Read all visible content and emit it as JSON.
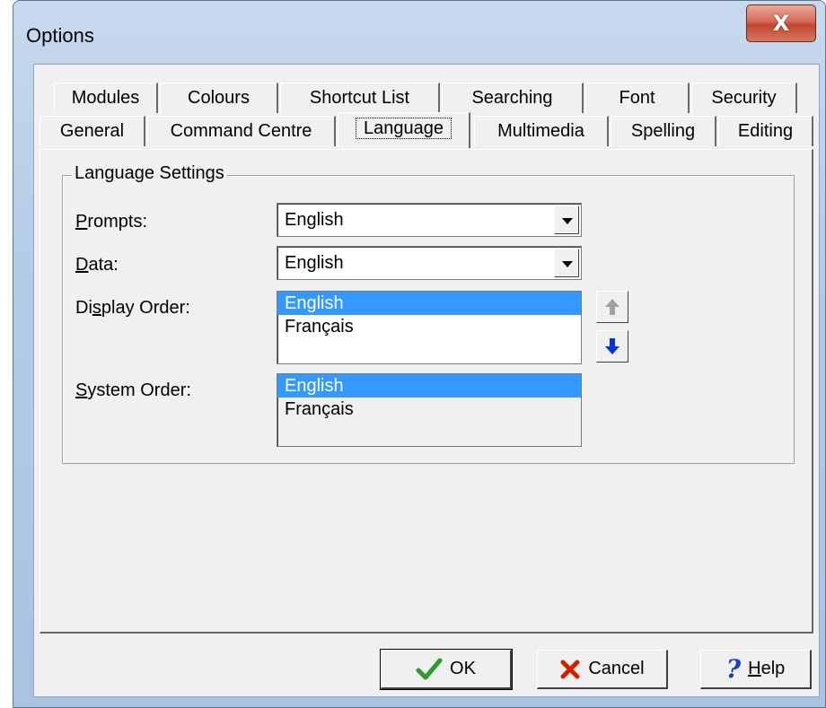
{
  "window": {
    "title": "Options",
    "close_glyph": "X"
  },
  "tabs_row1": [
    "Modules",
    "Colours",
    "Shortcut List",
    "Searching",
    "Font",
    "Security"
  ],
  "tabs_row2": [
    "General",
    "Command Centre",
    "Language",
    "Multimedia",
    "Spelling",
    "Editing"
  ],
  "active_tab": "Language",
  "group": {
    "legend": "Language Settings"
  },
  "prompts": {
    "label_first": "P",
    "label_rest": "rompts:",
    "value": "English"
  },
  "data_field": {
    "label_first": "D",
    "label_rest": "ata:",
    "value": "English"
  },
  "display_order": {
    "label_pre": "Di",
    "label_u": "s",
    "label_post": "play Order:",
    "items": [
      "English",
      "Français"
    ],
    "selected": "English"
  },
  "system_order": {
    "label_first": "S",
    "label_rest": "ystem Order:",
    "items": [
      "English",
      "Français"
    ],
    "selected": "English"
  },
  "buttons": {
    "ok": "OK",
    "cancel": "Cancel",
    "help_u": "H",
    "help_rest": "elp"
  },
  "colors": {
    "selection": "#3399ff",
    "ok_check": "#2e9b2e",
    "cancel_x": "#cc2200",
    "help_q": "#1a3fbf",
    "down_arrow": "#0033dd",
    "up_arrow_disabled": "#a0a0a0"
  },
  "icons": [
    "close-icon",
    "combo-arrow-icon",
    "move-up-icon",
    "move-down-icon",
    "checkmark-icon",
    "cancel-x-icon",
    "help-question-icon"
  ]
}
